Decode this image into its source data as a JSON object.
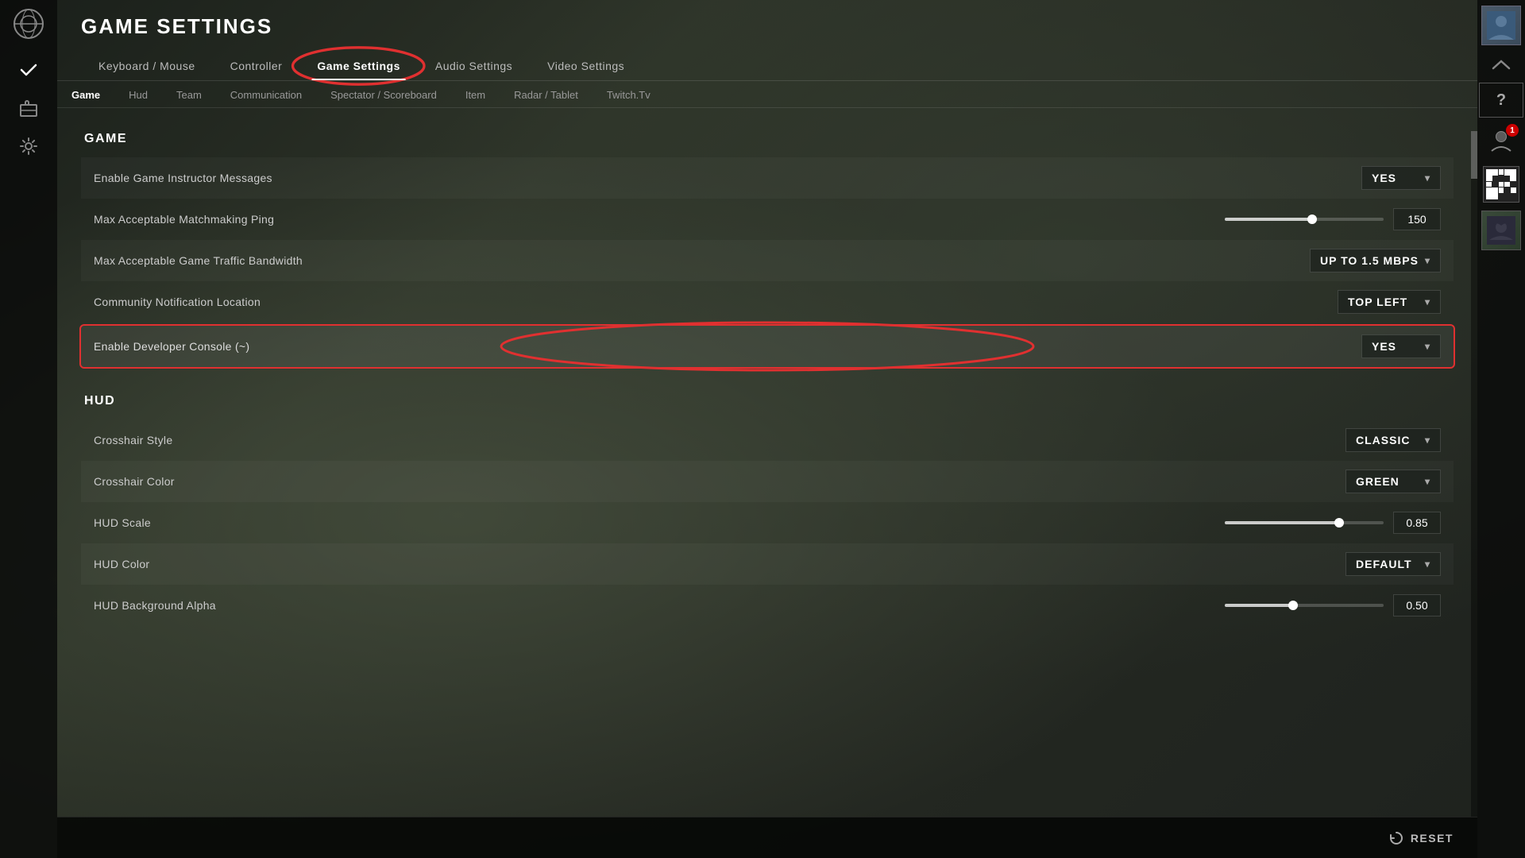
{
  "app": {
    "title": "GAME SETTINGS"
  },
  "primaryTabs": [
    {
      "id": "keyboard-mouse",
      "label": "Keyboard / Mouse",
      "active": false
    },
    {
      "id": "controller",
      "label": "Controller",
      "active": false
    },
    {
      "id": "game-settings",
      "label": "Game Settings",
      "active": true,
      "circled": true
    },
    {
      "id": "audio-settings",
      "label": "Audio Settings",
      "active": false
    },
    {
      "id": "video-settings",
      "label": "Video Settings",
      "active": false
    }
  ],
  "secondaryTabs": [
    {
      "id": "game",
      "label": "Game",
      "active": true
    },
    {
      "id": "hud",
      "label": "Hud",
      "active": false
    },
    {
      "id": "team",
      "label": "Team",
      "active": false
    },
    {
      "id": "communication",
      "label": "Communication",
      "active": false
    },
    {
      "id": "spectator-scoreboard",
      "label": "Spectator / Scoreboard",
      "active": false
    },
    {
      "id": "item",
      "label": "Item",
      "active": false
    },
    {
      "id": "radar-tablet",
      "label": "Radar / Tablet",
      "active": false
    },
    {
      "id": "twitchtv",
      "label": "Twitch.tv",
      "active": false
    }
  ],
  "sections": [
    {
      "id": "game",
      "label": "Game",
      "settings": [
        {
          "id": "enable-game-instructor",
          "label": "Enable Game Instructor Messages",
          "type": "dropdown",
          "value": "YES",
          "circled": false
        },
        {
          "id": "max-matchmaking-ping",
          "label": "Max Acceptable Matchmaking Ping",
          "type": "slider",
          "sliderPercent": 55,
          "value": "150"
        },
        {
          "id": "max-game-traffic",
          "label": "Max Acceptable Game Traffic Bandwidth",
          "type": "dropdown",
          "value": "UP TO 1.5 MBPS"
        },
        {
          "id": "community-notification",
          "label": "Community Notification Location",
          "type": "dropdown",
          "value": "TOP LEFT"
        },
        {
          "id": "enable-developer-console",
          "label": "Enable Developer Console (~)",
          "type": "dropdown",
          "value": "YES",
          "circled": true
        }
      ]
    },
    {
      "id": "hud",
      "label": "Hud",
      "settings": [
        {
          "id": "crosshair-style",
          "label": "Crosshair Style",
          "type": "dropdown",
          "value": "CLASSIC"
        },
        {
          "id": "crosshair-color",
          "label": "Crosshair Color",
          "type": "dropdown",
          "value": "GREEN"
        },
        {
          "id": "hud-scale",
          "label": "HUD Scale",
          "type": "slider",
          "sliderPercent": 72,
          "value": "0.85"
        },
        {
          "id": "hud-color",
          "label": "HUD Color",
          "type": "dropdown",
          "value": "DEFAULT"
        },
        {
          "id": "hud-background-alpha",
          "label": "HUD Background Alpha",
          "type": "slider",
          "sliderPercent": 43,
          "value": "0.50"
        }
      ]
    }
  ],
  "resetButton": {
    "label": "RESET",
    "icon": "↺"
  },
  "sidebarIcons": [
    {
      "id": "logo",
      "icon": "○",
      "active": false
    },
    {
      "id": "checkmark",
      "icon": "✓",
      "active": true
    },
    {
      "id": "briefcase",
      "icon": "⊟",
      "active": false
    },
    {
      "id": "gear",
      "icon": "⚙",
      "active": false
    }
  ],
  "rightSidebarItems": [
    {
      "id": "profile-main",
      "type": "avatar",
      "emoji": "👤"
    },
    {
      "id": "chevron-up",
      "type": "icon",
      "icon": "▲"
    },
    {
      "id": "question",
      "type": "icon",
      "icon": "?"
    },
    {
      "id": "user-count",
      "type": "icon",
      "icon": "👥",
      "badge": "1"
    },
    {
      "id": "qr-code",
      "type": "qr"
    },
    {
      "id": "batman",
      "type": "avatar",
      "emoji": "🦇"
    }
  ],
  "colors": {
    "accent": "#e03030",
    "background": "#1e221e",
    "surface": "rgba(0,0,0,0.4)",
    "text": "#cccccc",
    "textBright": "#ffffff"
  }
}
